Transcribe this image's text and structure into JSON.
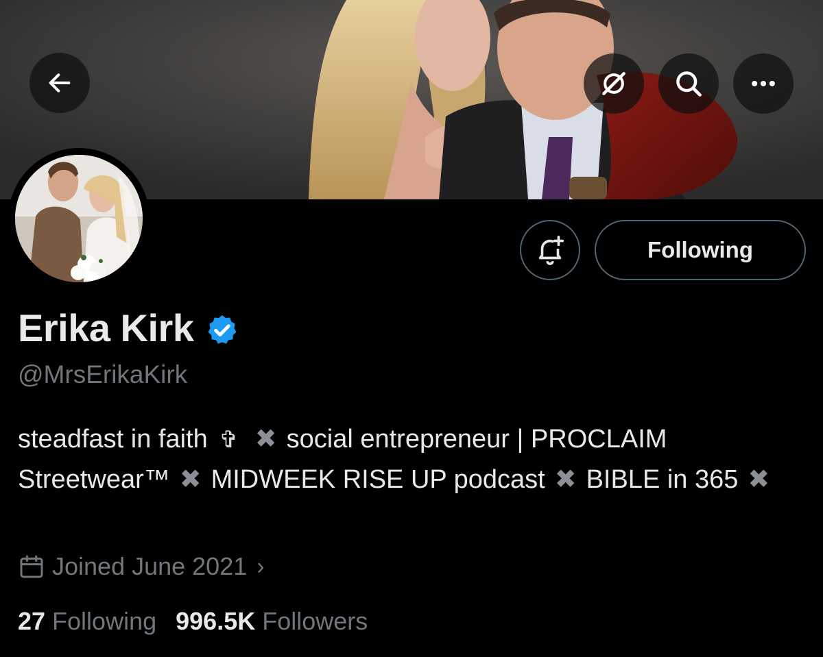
{
  "banner": {
    "description_icon": "profile-banner"
  },
  "nav": {
    "back_icon": "arrow-left-icon",
    "grok_icon": "grok-icon",
    "search_icon": "search-icon",
    "more_icon": "more-icon"
  },
  "profile": {
    "display_name": "Erika Kirk",
    "handle": "@MrsErikaKirk",
    "verified": true,
    "verified_color": "#1d9bf0",
    "bio": {
      "part1": "steadfast in faith",
      "cross": "✞",
      "sep": "✖",
      "part2": "social entrepreneur | PROCLAIM Streetwear™",
      "part3": "MIDWEEK RISE UP podcast",
      "part4": "BIBLE in 365"
    },
    "joined": "Joined June 2021",
    "following_count": "27",
    "following_label": "Following",
    "followers_count": "996.5K",
    "followers_label": "Followers"
  },
  "actions": {
    "notify_icon": "bell-plus-icon",
    "following_button": "Following"
  },
  "colors": {
    "background": "#000000",
    "primary_text": "#e7e9ea",
    "secondary_text": "#71767b",
    "border": "#536471",
    "verified": "#1d9bf0"
  }
}
